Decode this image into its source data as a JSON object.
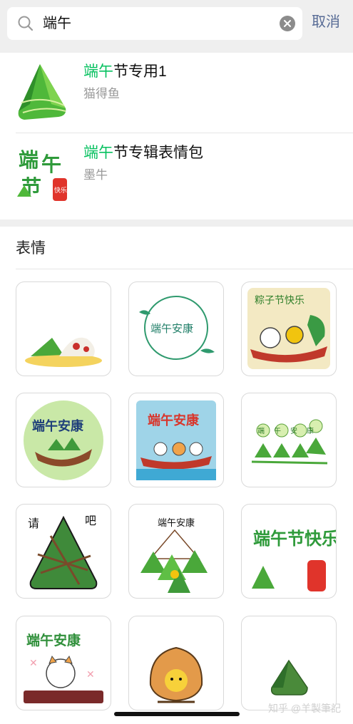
{
  "search": {
    "query": "端午",
    "cancel_label": "取消"
  },
  "results": [
    {
      "title_highlight": "端午",
      "title_rest": "节专用1",
      "author": "猫得鱼"
    },
    {
      "title_highlight": "端午",
      "title_rest": "节专辑表情包",
      "author": "墨牛"
    }
  ],
  "thumb_text": {
    "duan": "端",
    "wu": "午",
    "jie": "节",
    "kuaile": "快乐"
  },
  "section_title": "表情",
  "stickers": [
    {
      "name": "zongzi-plate",
      "text": ""
    },
    {
      "name": "duanwu-ankang-stamp",
      "text": "端午安康"
    },
    {
      "name": "zongzi-festival-boat",
      "text": "粽子节快乐"
    },
    {
      "name": "duanwu-ankang-boat-circle",
      "text": "端午安康"
    },
    {
      "name": "duanwu-ankang-dragon-boat",
      "text": "端午安康"
    },
    {
      "name": "duanwu-ankang-zongzi-row",
      "text": "端午安康"
    },
    {
      "name": "please-eat-zongzi",
      "text_left": "请",
      "text_right": "吧"
    },
    {
      "name": "zongzi-bundle",
      "text": "端午安康"
    },
    {
      "name": "duanwu-jie-kuaile",
      "text": "端午节快乐"
    },
    {
      "name": "cat-duanwu-ankang",
      "text": "端午安康"
    },
    {
      "name": "rice-ball-face",
      "text": ""
    },
    {
      "name": "small-zongzi",
      "text": ""
    }
  ],
  "watermark": "知乎 @羊製筆記"
}
